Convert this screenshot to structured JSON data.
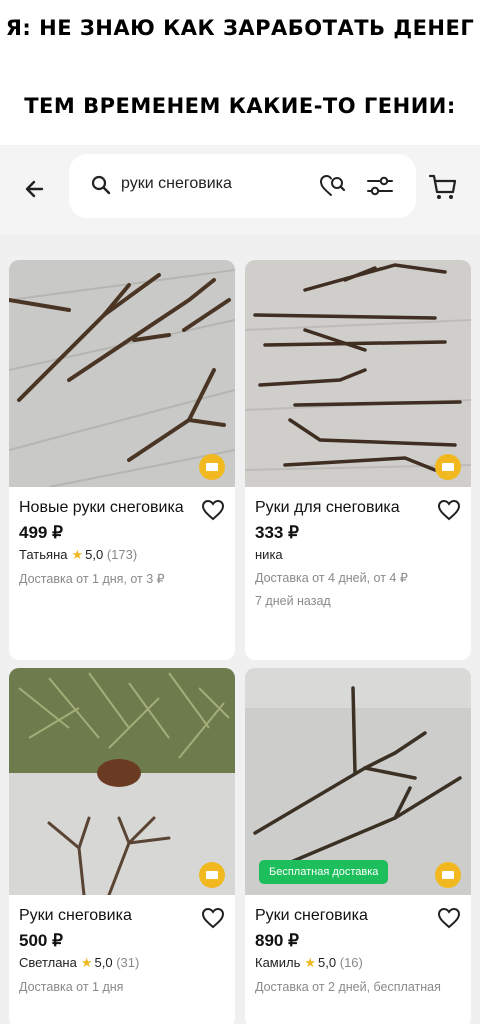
{
  "meme": {
    "line1": "Я: НЕ ЗНАЮ КАК ЗАРАБОТАТЬ ДЕНЕГ",
    "line2": "ТЕМ ВРЕМЕНЕМ КАКИЕ-ТО ГЕНИИ:"
  },
  "search": {
    "query": "руки снеговика"
  },
  "colors": {
    "accent_yellow": "#f2b820",
    "free_delivery_green": "#1cbf5b"
  },
  "products": [
    {
      "title": "Новые руки снеговика",
      "price": "499 ₽",
      "seller": "Татьяна",
      "rating": "5,0",
      "reviews": "(173)",
      "delivery": "Доставка от 1 дня, от 3 ₽"
    },
    {
      "title": "Руки для снеговика",
      "price": "333 ₽",
      "seller": "ника",
      "delivery": "Доставка от 4 дней, от 4 ₽",
      "posted": "7 дней назад"
    },
    {
      "title": "Руки снеговика",
      "price": "500 ₽",
      "seller": "Светлана",
      "rating": "5,0",
      "reviews": "(31)",
      "delivery": "Доставка от 1 дня"
    },
    {
      "title": "Руки снеговика",
      "price": "890 ₽",
      "seller": "Камиль",
      "rating": "5,0",
      "reviews": "(16)",
      "delivery": "Доставка от 2 дней, бесплатная",
      "badge": "Бесплатная доставка"
    }
  ]
}
